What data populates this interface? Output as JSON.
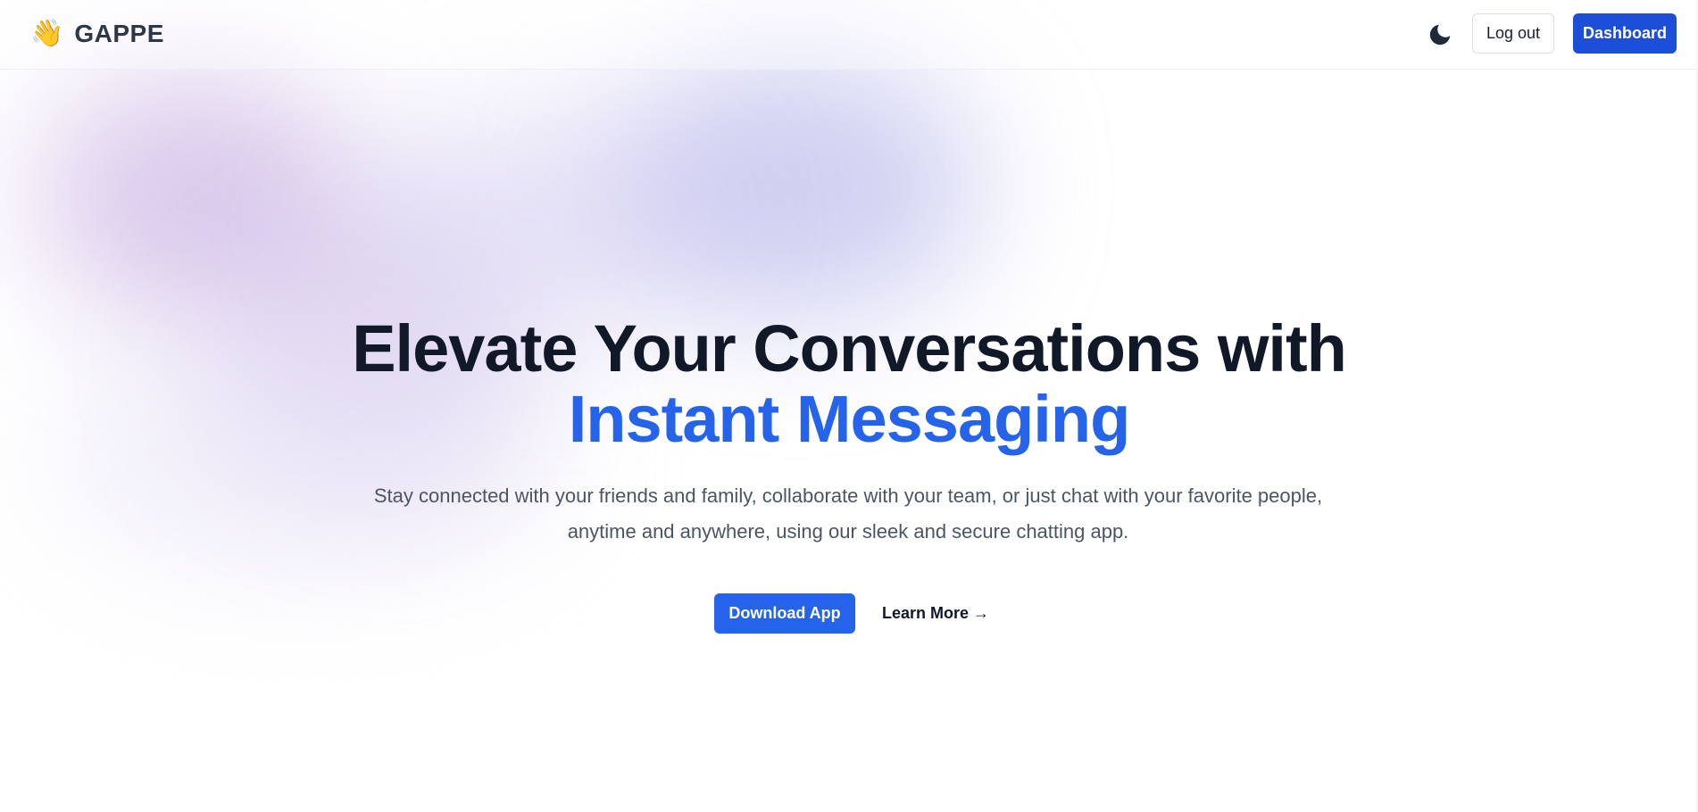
{
  "brand": {
    "emoji": "👋",
    "name": "GAPPE"
  },
  "header": {
    "theme_toggle_icon": "moon-icon",
    "logout_label": "Log out",
    "dashboard_label": "Dashboard"
  },
  "hero": {
    "headline": "Elevate Your Conversations with",
    "headline_accent": "Instant Messaging",
    "subtitle": "Stay connected with your friends and family, collaborate with your team, or just chat with your favorite people, anytime and anywhere, using our sleek and secure chatting app.",
    "download_label": "Download App",
    "learn_more_label": "Learn More →"
  },
  "colors": {
    "accent": "#2563eb",
    "dashboard_button": "#1d4ed8",
    "heading": "#111827",
    "body_text": "#4b5563"
  }
}
